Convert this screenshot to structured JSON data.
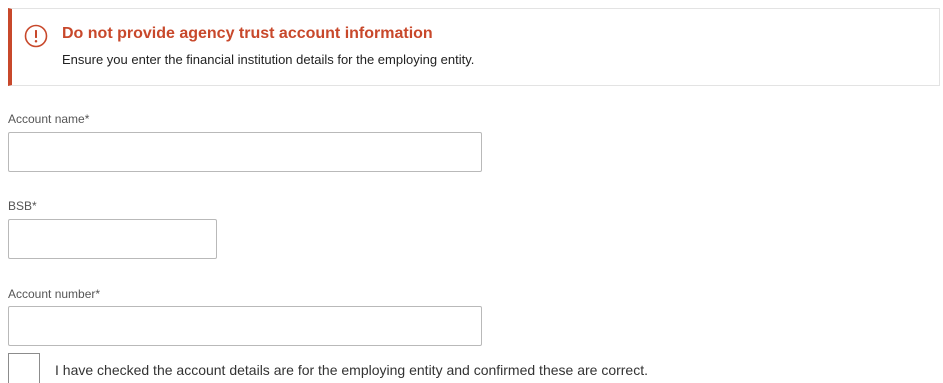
{
  "alert": {
    "icon": "exclamation-circle-icon",
    "title": "Do not provide agency trust account information",
    "message": "Ensure you enter the financial institution details for the employing entity.",
    "accent_color": "#c8482b"
  },
  "form": {
    "account_name": {
      "label": "Account name*",
      "value": ""
    },
    "bsb": {
      "label": "BSB*",
      "value": ""
    },
    "account_number": {
      "label": "Account number*",
      "value": ""
    },
    "confirmation": {
      "checked": false,
      "label": "I have checked the account details are for the employing entity and confirmed these are correct."
    }
  }
}
